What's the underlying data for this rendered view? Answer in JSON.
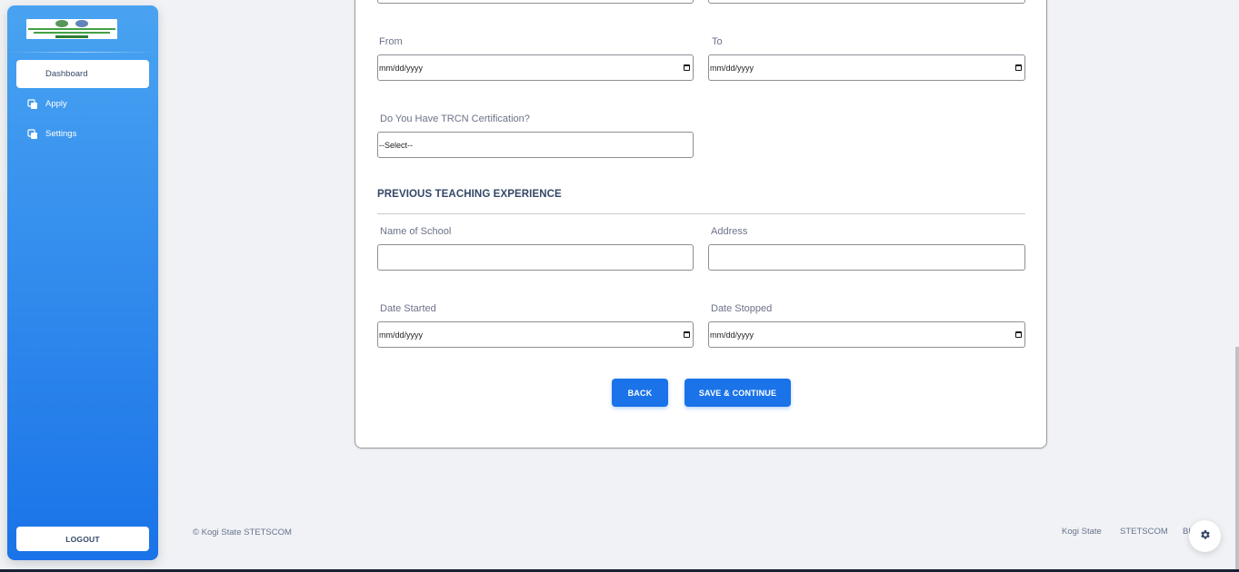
{
  "sidebar": {
    "nav": [
      {
        "label": "Dashboard",
        "active": true
      },
      {
        "label": "Apply",
        "icon": "copy-icon"
      },
      {
        "label": "Settings",
        "icon": "copy-icon"
      }
    ],
    "logout_label": "LOGOUT"
  },
  "form": {
    "from": {
      "label": "From",
      "placeholder": "mm/dd/yyyy"
    },
    "to": {
      "label": "To",
      "placeholder": "mm/dd/yyyy"
    },
    "trcn": {
      "label": "Do You Have TRCN Certification?",
      "value": "--Select--"
    },
    "section_title": "PREVIOUS TEACHING EXPERIENCE",
    "school_name": {
      "label": "Name of School",
      "value": ""
    },
    "address": {
      "label": "Address",
      "value": ""
    },
    "date_started": {
      "label": "Date Started",
      "placeholder": "mm/dd/yyyy"
    },
    "date_stopped": {
      "label": "Date Stopped",
      "placeholder": "mm/dd/yyyy"
    },
    "back_label": "BACK",
    "save_label": "SAVE & CONTINUE"
  },
  "footer": {
    "copyright": "© Kogi State STETSCOM",
    "links": [
      "Kogi State",
      "STETSCOM",
      "Bl"
    ]
  },
  "colors": {
    "primary": "#1A73E8",
    "sidebar_top": "#49a3f1"
  }
}
